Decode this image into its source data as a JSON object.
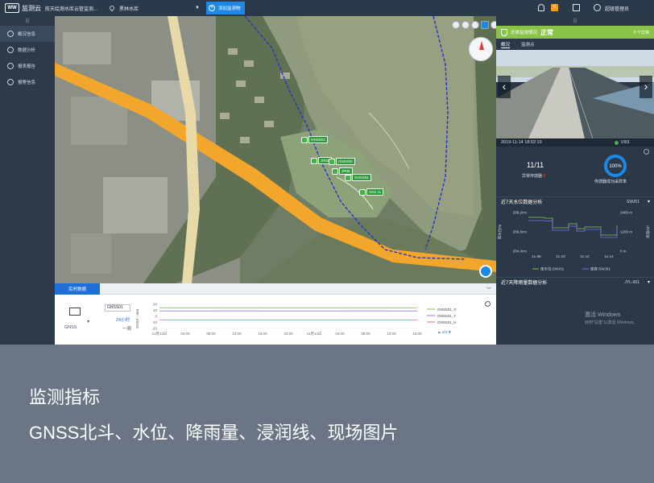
{
  "topbar": {
    "logo_mark": "WW",
    "brand": "监测云",
    "project": "航天绘测水库云管监测...",
    "site": "黑林水库",
    "add_button": "添加监测物",
    "badge_count": "0",
    "user": "超级管理员"
  },
  "sidebar": {
    "items": [
      {
        "label": "概况信息",
        "icon": "overview-icon"
      },
      {
        "label": "数据分析",
        "icon": "analysis-icon"
      },
      {
        "label": "报表报告",
        "icon": "report-icon"
      },
      {
        "label": "报警信息",
        "icon": "alarm-icon"
      }
    ]
  },
  "map": {
    "markers": [
      "GNSS03",
      "JR03",
      "GNSS02",
      "JR06",
      "GNSS01",
      "VI01 11"
    ],
    "colors": {
      "water": "#8f9b7c",
      "road": "#f2a62b",
      "boundary": "#2233cc",
      "marker": "#3fb548"
    }
  },
  "bottom": {
    "tab": "实时数据",
    "sensor_type": "GNSS",
    "sensor_select": "GNSS01",
    "period": "24小时",
    "period_alt": "一周",
    "y_label": "GNSS - mm",
    "legend": [
      "GNSS01_X",
      "GNSS01_Y",
      "GNSS01_H"
    ],
    "page_indicator": "1/3",
    "chart_data": {
      "type": "line",
      "x": [
        "11月13日",
        "04:00",
        "08:00",
        "12:00",
        "16:00",
        "20:00",
        "11月14日",
        "04:00",
        "08:00",
        "12:00",
        "16:00"
      ],
      "yticks": [
        "20",
        "10",
        "0",
        "-10",
        "-20"
      ],
      "ylim": [
        -20,
        20
      ],
      "series": [
        {
          "name": "GNSS01_X",
          "color": "#8bc34a",
          "values": [
            14,
            14,
            13.8,
            14,
            14,
            14,
            13.8,
            14,
            14,
            14,
            14
          ]
        },
        {
          "name": "GNSS01_Y",
          "color": "#9c6fe8",
          "values": [
            9,
            9,
            9,
            9.2,
            9,
            9,
            9,
            9,
            9.2,
            9,
            9
          ]
        },
        {
          "name": "GNSS01_H",
          "color": "#f06292",
          "values": [
            -6,
            -6,
            -6,
            -6,
            -6,
            -6,
            -6,
            -6,
            -6,
            -6,
            -6
          ]
        }
      ]
    }
  },
  "right": {
    "status_label": "总体监测情况",
    "status_value": "正常",
    "abnormal_count": "0 个异常",
    "tabs": [
      "概况",
      "监测点"
    ],
    "photo_time": "2019-11-14 18:02:19",
    "camera": "VI01",
    "sensors_ok": "11/11",
    "abnormal_label": "异常传感器",
    "abnormal_value": "0",
    "rate_value": "100%",
    "rate": 100,
    "rate_label": "传感器成功采样率",
    "water_title": "近7天水位数据分析",
    "water_code": "SWJ01",
    "rain_title": "近7天降雨量数据分析",
    "rain_code": "JYL-001",
    "water_chart": {
      "type": "line",
      "ylabel_left": "库水位/m",
      "ylabel_right": "库容/m³",
      "left_ticks": [
        "289.2cm",
        "286.8cm",
        "284.4cm"
      ],
      "right_ticks": [
        "2400 m",
        "1200 m",
        "0 m"
      ],
      "x": [
        "11-08",
        "11-10",
        "11-12",
        "11-14"
      ],
      "legend": [
        "库水位:SWJ01",
        "库容:SWJ01"
      ],
      "series": [
        {
          "name": "库水位:SWJ01",
          "color": "#8bc34a",
          "values": [
            288.6,
            288.6,
            288.5,
            287.3,
            287.3,
            287.8,
            287.2,
            287.4,
            287.4,
            286.4,
            286.4,
            287.6
          ]
        },
        {
          "name": "库容:SWJ01",
          "color": "#7c6ff0",
          "values": [
            1900,
            1900,
            1880,
            1300,
            1300,
            1550,
            1250,
            1350,
            1350,
            850,
            850,
            1450
          ]
        }
      ]
    },
    "watermark_title": "激活 Windows",
    "watermark_sub": "转到\"设置\"以激活 Windows。"
  },
  "caption": {
    "line1": "监测指标",
    "line2": "GNSS北斗、水位、降雨量、浸润线、现场图片"
  }
}
